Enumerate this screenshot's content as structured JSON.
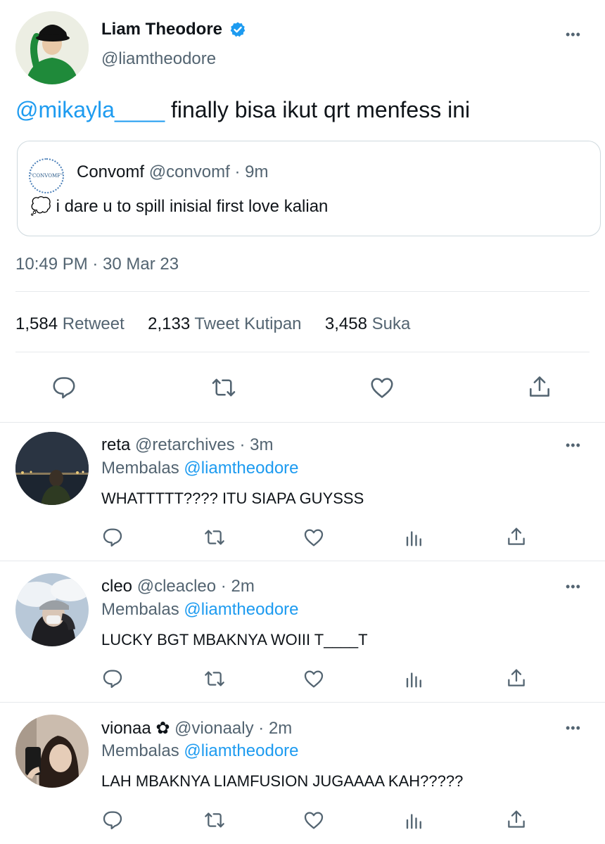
{
  "tweet": {
    "author_name": "Liam Theodore",
    "author_handle": "@liamtheodore",
    "mention": "@mikayla____",
    "text": " finally bisa ikut qrt menfess ini",
    "quote": {
      "name": "Convomf",
      "handle": "@convomf",
      "sep": "·",
      "time": "9m",
      "avatar_text": "\"CONVOMF\"",
      "emoji": "💭",
      "text": "i dare u to spill inisial first love kalian"
    },
    "timestamp": "10:49 PM · 30 Mar 23",
    "stats": {
      "retweet_count": "1,584",
      "retweet_label": "Retweet",
      "quote_count": "2,133",
      "quote_label": "Tweet Kutipan",
      "like_count": "3,458",
      "like_label": "Suka"
    },
    "actions": [
      "reply-icon",
      "retweet-icon",
      "like-icon",
      "share-icon"
    ]
  },
  "replies": [
    {
      "name": "reta",
      "handle": "@retarchives",
      "sep": "·",
      "time": "3m",
      "replying_label": "Membalas",
      "replying_to": "@liamtheodore",
      "text": "WHATTTTT???? ITU SIAPA GUYSSS"
    },
    {
      "name": "cleo",
      "handle": "@cleacleo",
      "sep": "·",
      "time": "2m",
      "replying_label": "Membalas",
      "replying_to": "@liamtheodore",
      "text": "LUCKY BGT MBAKNYA WOIII T____T"
    },
    {
      "name": "vionaa ✿",
      "handle": "@vionaaly",
      "sep": "·",
      "time": "2m",
      "replying_label": "Membalas",
      "replying_to": "@liamtheodore",
      "text": "LAH MBAKNYA LIAMFUSION JUGAAAA KAH?????"
    }
  ],
  "more_glyph": "•••",
  "colors": {
    "accent": "#1d9bf0",
    "secondary": "#536471",
    "divider": "#e6e9ec"
  }
}
